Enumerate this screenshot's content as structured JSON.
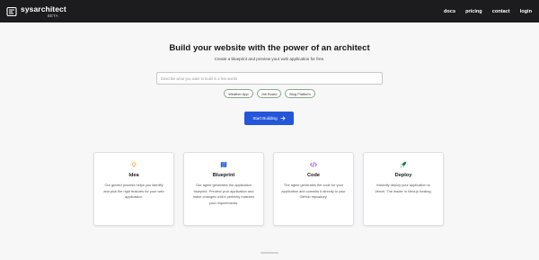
{
  "navbar": {
    "brand": "sysarchitect",
    "beta": "BETA",
    "links": [
      "docs",
      "pricing",
      "contact",
      "login"
    ]
  },
  "hero": {
    "title": "Build your website with the power of an architect",
    "subtitle": "Create a blueprint and preview your web application for free.",
    "input_placeholder": "Describe what you want to build in a few words",
    "input_value": "",
    "chips": [
      "Weather App",
      "Job Board",
      "Blog Platform"
    ],
    "start_label": "Start Building"
  },
  "cards": [
    {
      "icon": "lightbulb-icon",
      "title": "Idea",
      "description": "Our guided process helps you identify and pick the right features for your web application."
    },
    {
      "icon": "blueprint-icon",
      "title": "Blueprint",
      "description": "Our agent generates the application blueprint. Preview your application and make changes until it perfectly matches your requirements."
    },
    {
      "icon": "code-icon",
      "title": "Code",
      "description": "The agent generates the code for your application and commits it directly to your GitHub repository."
    },
    {
      "icon": "rocket-icon",
      "title": "Deploy",
      "description": "Instantly deploy your application to Vercel. The leader in Next.js hosting."
    }
  ],
  "colors": {
    "navbar_bg": "#1c1c1f",
    "page_bg": "#f7f7f8",
    "primary_button": "#2556d9",
    "idea_icon": "#f5a623",
    "blueprint_icon": "#2b5bd7",
    "code_icon": "#8b3fd1",
    "deploy_icon": "#15803d"
  }
}
